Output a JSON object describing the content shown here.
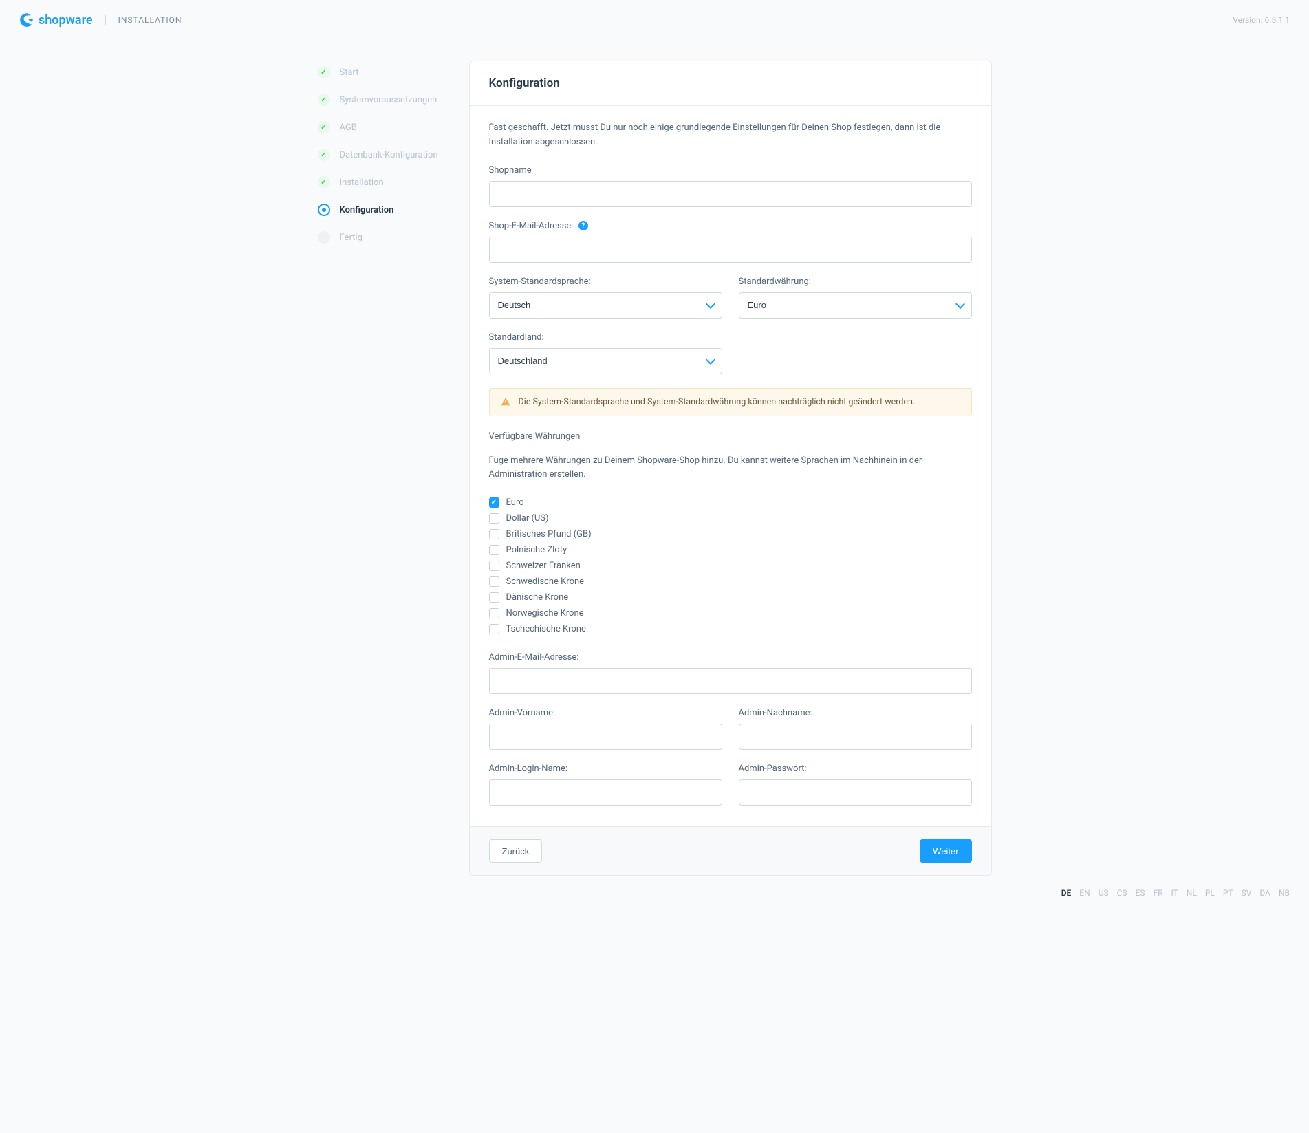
{
  "header": {
    "brand": "shopware",
    "title": "INSTALLATION",
    "version": "Version: 6.5.1.1"
  },
  "steps": [
    {
      "label": "Start",
      "state": "done"
    },
    {
      "label": "Systemvoraussetzungen",
      "state": "done"
    },
    {
      "label": "AGB",
      "state": "done"
    },
    {
      "label": "Datenbank-Konfiguration",
      "state": "done"
    },
    {
      "label": "Installation",
      "state": "done"
    },
    {
      "label": "Konfiguration",
      "state": "active"
    },
    {
      "label": "Fertig",
      "state": "pending"
    }
  ],
  "card": {
    "title": "Konfiguration",
    "intro": "Fast geschafft. Jetzt musst Du nur noch einige grundlegende Einstellungen für Deinen Shop festlegen, dann ist die Installation abgeschlossen.",
    "labels": {
      "shopname": "Shopname",
      "shopemail": "Shop-E-Mail-Adresse:",
      "syslang": "System-Standardsprache:",
      "currency": "Standardwährung:",
      "country": "Standardland:",
      "available": "Verfügbare Währungen",
      "available_desc": "Füge mehrere Währungen zu Deinem Shopware-Shop hinzu. Du kannst weitere Sprachen im Nachhinein in der Administration erstellen.",
      "admin_email": "Admin-E-Mail-Adresse:",
      "admin_first": "Admin-Vorname:",
      "admin_last": "Admin-Nachname:",
      "admin_login": "Admin-Login-Name:",
      "admin_pass": "Admin-Passwort:"
    },
    "values": {
      "syslang": "Deutsch",
      "currency": "Euro",
      "country": "Deutschland"
    },
    "alert": "Die System-Standardsprache und System-Standardwährung können nachträglich nicht geändert werden.",
    "currencies": [
      {
        "label": "Euro",
        "checked": true
      },
      {
        "label": "Dollar (US)",
        "checked": false
      },
      {
        "label": "Britisches Pfund (GB)",
        "checked": false
      },
      {
        "label": "Polnische Zloty",
        "checked": false
      },
      {
        "label": "Schweizer Franken",
        "checked": false
      },
      {
        "label": "Schwedische Krone",
        "checked": false
      },
      {
        "label": "Dänische Krone",
        "checked": false
      },
      {
        "label": "Norwegische Krone",
        "checked": false
      },
      {
        "label": "Tschechische Krone",
        "checked": false
      }
    ],
    "buttons": {
      "back": "Zurück",
      "next": "Weiter"
    }
  },
  "footer_langs": [
    "DE",
    "EN",
    "US",
    "CS",
    "ES",
    "FR",
    "IT",
    "NL",
    "PL",
    "PT",
    "SV",
    "DA",
    "NB"
  ],
  "footer_active": "DE"
}
